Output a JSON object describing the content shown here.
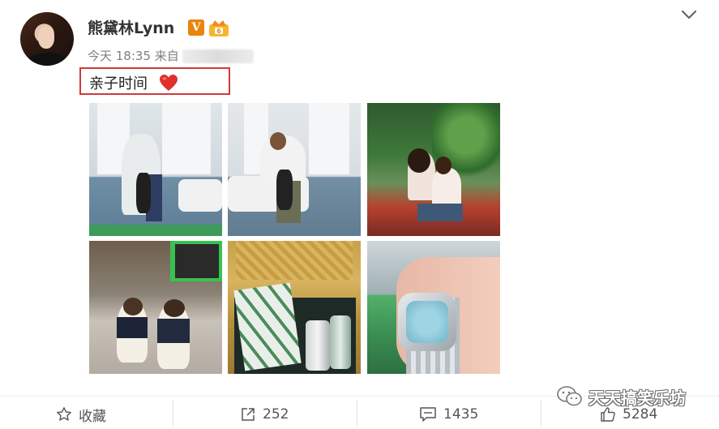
{
  "post": {
    "author": "熊黛林Lynn",
    "time": "今天 18:35",
    "source_prefix": "来自",
    "text": "亲子时间",
    "verified_badge": "V"
  },
  "photos": [
    {
      "name": "photo-family-living-room"
    },
    {
      "name": "photo-father-child-living-room"
    },
    {
      "name": "photo-two-women-sofa"
    },
    {
      "name": "photo-two-girls"
    },
    {
      "name": "photo-gift-basket"
    },
    {
      "name": "photo-wristwatch"
    }
  ],
  "toolbar": {
    "favorite_label": "收藏",
    "repost_count": "252",
    "comment_count": "1435",
    "like_count": "5284"
  },
  "watermark": {
    "text": "天天搞笑乐坊"
  },
  "colors": {
    "highlight_border": "#d0393a",
    "verified_orange": "#e8850c",
    "heart_red": "#e0302a"
  },
  "icons": [
    "chevron-down-icon",
    "heart-icon",
    "star-icon",
    "repost-icon",
    "comment-icon",
    "thumbs-up-icon",
    "wechat-icon",
    "crown-badge-icon"
  ]
}
